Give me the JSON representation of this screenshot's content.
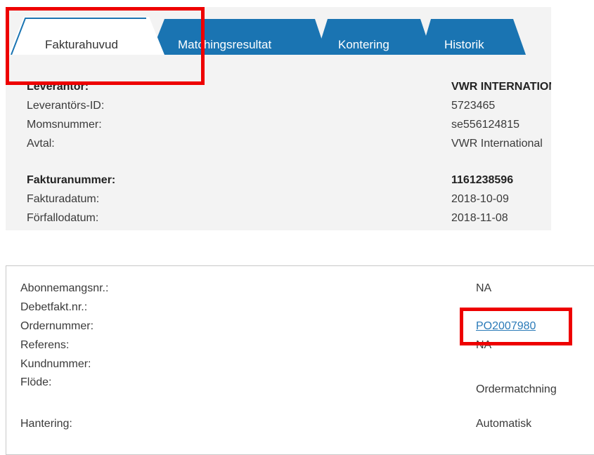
{
  "tabs": [
    {
      "label": "Fakturahuvud",
      "active": true
    },
    {
      "label": "Matchingsresultat",
      "active": false
    },
    {
      "label": "Kontering",
      "active": false
    },
    {
      "label": "Historik",
      "active": false
    }
  ],
  "supplier": {
    "leverantor_label": "Leverantör:",
    "leverantor_value": "VWR INTERNATIONAL",
    "leverantors_id_label": "Leverantörs-ID:",
    "leverantors_id_value": "5723465",
    "momsnummer_label": "Momsnummer:",
    "momsnummer_value": "se556124815",
    "avtal_label": "Avtal:",
    "avtal_value": "VWR International"
  },
  "invoice": {
    "fakturanummer_label": "Fakturanummer:",
    "fakturanummer_value": "1161238596",
    "fakturadatum_label": "Fakturadatum:",
    "fakturadatum_value": "2018-10-09",
    "forfallodatum_label": "Förfallodatum:",
    "forfallodatum_value": "2018-11-08"
  },
  "details": {
    "abonnemangsnr_label": "Abonnemangsnr.:",
    "abonnemangsnr_value": "NA",
    "debetfakt_label": "Debetfakt.nr.:",
    "ordernummer_label": "Ordernummer:",
    "ordernummer_value": "PO2007980",
    "referens_label": "Referens:",
    "referens_value": "NA",
    "kundnummer_label": "Kundnummer:",
    "flode_label": "Flöde:",
    "flode_value": "Ordermatchning",
    "hantering_label": "Hantering:",
    "hantering_value": "Automatisk"
  },
  "colors": {
    "tab_active_bg": "#ffffff",
    "tab_inactive_bg": "#1a74b2",
    "tab_border": "#1a74b2",
    "panel_bg": "#f3f3f3",
    "link": "#2a7ab8",
    "highlight": "#ee0000"
  }
}
